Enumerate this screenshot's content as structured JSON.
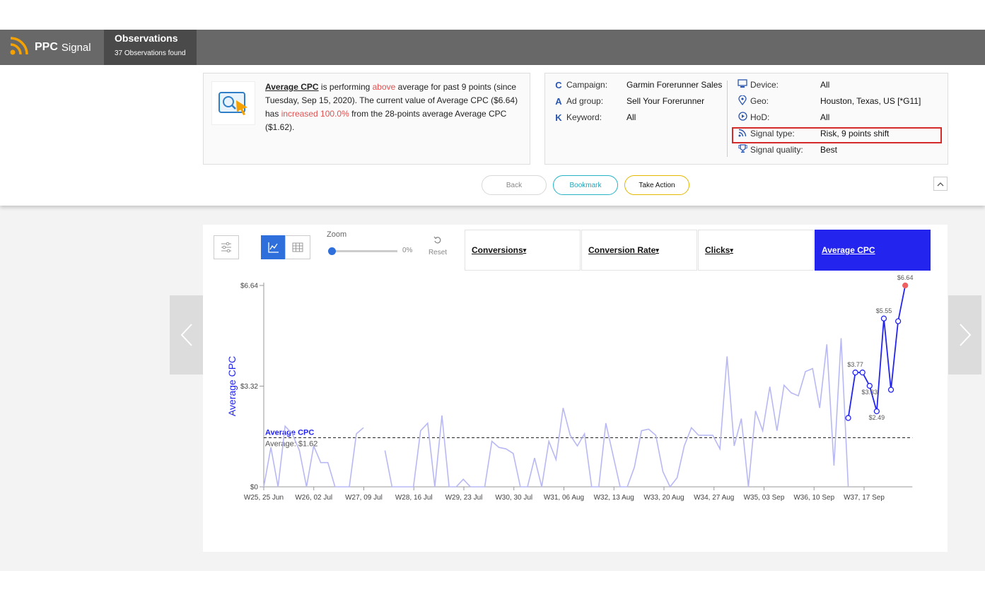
{
  "header": {
    "brand_ppc": "PPC",
    "brand_signal": "Signal",
    "tab_title": "Observations",
    "tab_subtitle": "37 Observations found"
  },
  "observation": {
    "metric": "Average CPC",
    "t1": " is performing ",
    "direction": "above",
    "t2": " average for past 9 points (since Tuesday, Sep 15, 2020). The current value of Average CPC ($6.64) has ",
    "change": "increased 100.0%",
    "t3": " from the 28-points average Average CPC ($1.62)."
  },
  "details": {
    "campaign_label": "Campaign:",
    "campaign": "Garmin Forerunner Sales",
    "adgroup_label": "Ad group:",
    "adgroup": "Sell Your Forerunner",
    "keyword_label": "Keyword:",
    "keyword": "All",
    "device_label": "Device:",
    "device": "All",
    "geo_label": "Geo:",
    "geo": "Houston, Texas, US [*G11]",
    "hod_label": "HoD:",
    "hod": "All",
    "signal_type_label": "Signal type:",
    "signal_type": "Risk, 9 points shift",
    "signal_quality_label": "Signal quality:",
    "signal_quality": "Best"
  },
  "actions": {
    "back": "Back",
    "bookmark": "Bookmark",
    "take_action": "Take Action"
  },
  "controls": {
    "zoom_label": "Zoom",
    "zoom_value": "0%",
    "reset": "Reset",
    "zoom_level": 0
  },
  "metric_tabs": [
    {
      "label": "Conversions",
      "arrow": "▾"
    },
    {
      "label": "Conversion Rate",
      "arrow": "▾"
    },
    {
      "label": "Clicks",
      "arrow": "▾"
    },
    {
      "label": "Average CPC",
      "arrow": ""
    }
  ],
  "colors": {
    "accent": "#2424ef",
    "history_line": "#b8b8f4",
    "highlight": "#d42a2a",
    "alert_dot": "#f06060",
    "up_text": "#e05050",
    "take_action_border": "#e3b800",
    "bookmark_border": "#27b3c6"
  },
  "chart_data": {
    "type": "line",
    "ylabel": "Average CPC",
    "ylim": [
      0,
      6.64
    ],
    "y_ticks": [
      "$0",
      "$3.32",
      "$6.64"
    ],
    "y_tick_values": [
      0,
      3.32,
      6.64
    ],
    "x_tick_labels": [
      "W25, 25 Jun",
      "W26, 02 Jul",
      "W27, 09 Jul",
      "W28, 16 Jul",
      "W29, 23 Jul",
      "W30, 30 Jul",
      "W31, 06 Aug",
      "W32, 13 Aug",
      "W33, 20 Aug",
      "W34, 27 Aug",
      "W35, 03 Sep",
      "W36, 10 Sep",
      "W37, 17 Sep"
    ],
    "highlight_tick": "W37, 17 Sep",
    "average_value": 1.62,
    "average_line_label": "Average CPC",
    "average_text": "Average: $1.62",
    "series": [
      {
        "role": "history",
        "values": [
          0,
          1.3,
          0,
          2.0,
          1.75,
          1.2,
          0,
          1.35,
          0.8,
          0.8,
          0,
          0,
          0,
          1.75,
          1.95,
          null,
          null,
          1.2,
          0,
          0,
          0,
          0,
          1.85,
          2.1,
          0,
          2.35,
          0,
          0,
          0.25,
          0,
          0,
          0,
          1.5,
          1.3,
          1.25,
          1.1,
          0,
          0,
          0.95,
          0,
          1.5,
          0.9,
          2.6,
          1.7,
          1.35,
          1.75,
          0,
          0,
          2.1,
          1.05,
          0,
          0,
          0.65,
          1.85,
          1.9,
          1.7,
          0.5,
          0,
          0.3,
          1.35,
          1.95,
          1.7,
          1.7,
          1.7,
          1.25,
          4.3,
          1.35,
          2.25,
          0,
          2.5,
          1.85,
          3.3,
          1.85,
          3.35,
          3.1,
          3.0,
          3.8,
          3.9,
          2.6,
          4.7,
          0.7,
          4.9,
          0
        ]
      },
      {
        "role": "current",
        "name": "Average CPC",
        "values": [
          2.27,
          3.77,
          3.77,
          3.33,
          2.49,
          5.55,
          3.2,
          5.46,
          6.64
        ],
        "point_labels": [
          "",
          "$3.77",
          "",
          "$3.33",
          "$2.49",
          "$5.55",
          "",
          "",
          "$6.64"
        ]
      }
    ]
  }
}
